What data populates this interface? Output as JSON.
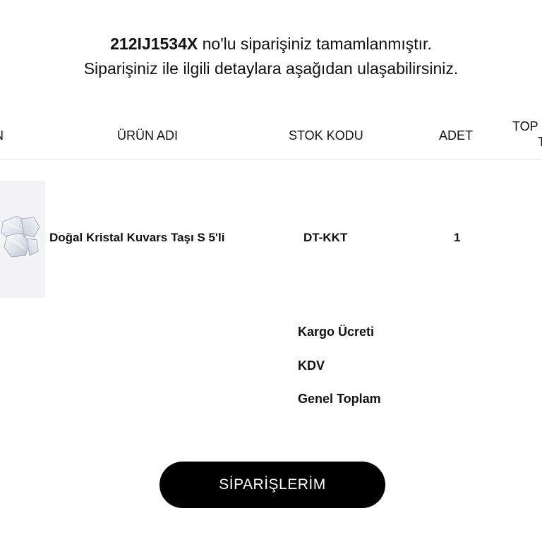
{
  "confirmation": {
    "order_number": "212IJ1534X",
    "line1_suffix": " no'lu siparişiniz tamamlanmıştır.",
    "line2": "Siparişiniz ile ilgili detaylara aşağıdan ulaşabilirsiniz."
  },
  "table": {
    "headers": {
      "image": "N",
      "name": "ÜRÜN ADI",
      "stock": "STOK KODU",
      "qty": "ADET",
      "total_line1": "TOP",
      "total_line2": "T"
    },
    "rows": [
      {
        "product_image": "crystal-quartz-stones-image",
        "name": "Doğal Kristal Kuvars Taşı S 5'li",
        "stock_code": "DT-KKT",
        "quantity": "1"
      }
    ]
  },
  "summary": {
    "shipping_label": "Kargo Ücreti",
    "vat_label": "KDV",
    "grand_total_label": "Genel Toplam"
  },
  "actions": {
    "orders_button_label": "SİPARİŞLERİM"
  }
}
